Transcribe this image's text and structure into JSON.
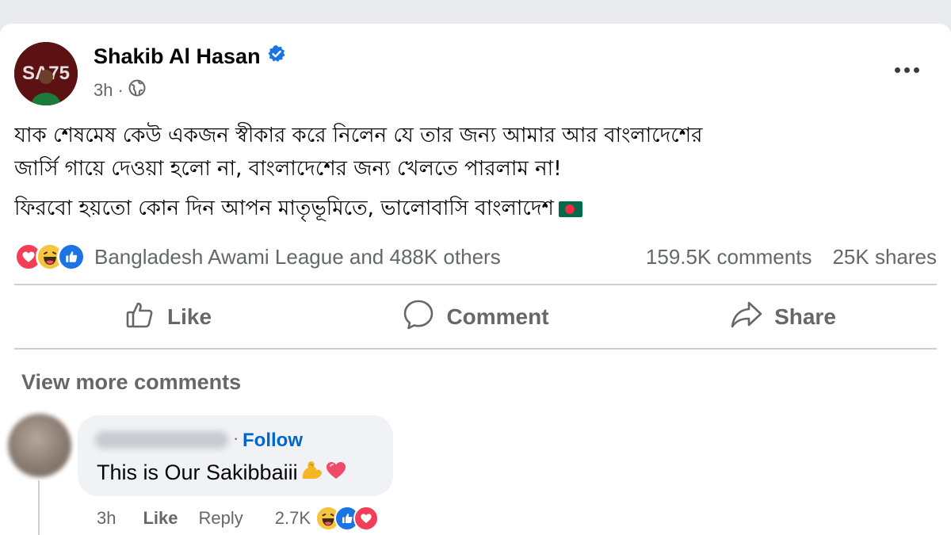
{
  "post": {
    "author": "Shakib Al Hasan",
    "avatar_text": "SA75",
    "time": "3h",
    "time_separator": "·",
    "paragraphs": [
      "যাক শেষমেষ কেউ একজন স্বীকার করে নিলেন যে তার  জন্য আমার আর বাংলাদেশের",
      "জার্সি গায়ে দেওয়া হলো না, বাংলাদেশের জন্য খেলতে পারলাম না!",
      "ফিরবো হয়তো কোন দিন আপন মাতৃভূমিতে, ভালোবাসি বাংলাদেশ"
    ]
  },
  "reactions": {
    "icons": [
      "love",
      "haha",
      "like"
    ],
    "summary": "Bangladesh Awami League and 488K others",
    "comments": "159.5K comments",
    "shares": "25K shares"
  },
  "actions": {
    "like": "Like",
    "comment": "Comment",
    "share": "Share"
  },
  "view_more": "View more comments",
  "comment": {
    "follow": "Follow",
    "text": "This is Our Sakibbaiii",
    "time": "3h",
    "like": "Like",
    "reply": "Reply",
    "reaction_count": "2.7K"
  },
  "colors": {
    "text": "#050505",
    "secondary": "#65676b",
    "link": "#0064d1",
    "verified": "#1b74e4",
    "love": "#f33e58",
    "haha": "#f7c43f",
    "like": "#1b74e4"
  }
}
